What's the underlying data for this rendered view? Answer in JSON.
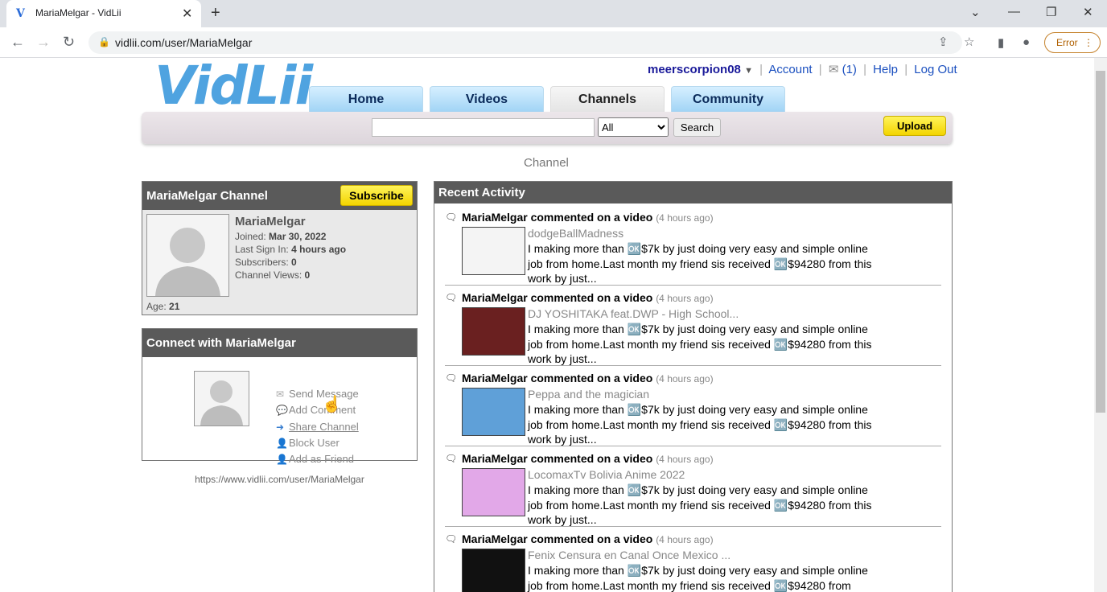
{
  "browser": {
    "tab_title": "MariaMelgar - VidLii",
    "tab_favicon": "vidlii-favicon-icon",
    "url": "vidlii.com/user/MariaMelgar",
    "error_label": "Error"
  },
  "site": {
    "logo_text": "VidLii",
    "username": "meerscorpion08",
    "account_link": "Account",
    "notifications": "(1)",
    "help_link": "Help",
    "logout_link": "Log Out",
    "nav_tabs": [
      {
        "label": "Home",
        "active": false
      },
      {
        "label": "Videos",
        "active": false
      },
      {
        "label": "Channels",
        "active": true
      },
      {
        "label": "Community",
        "active": false
      }
    ],
    "search": {
      "value": "",
      "category": "All",
      "button": "Search"
    },
    "upload": "Upload",
    "section_label": "Channel"
  },
  "profile": {
    "box_title": "MariaMelgar Channel",
    "subscribe": "Subscribe",
    "name": "MariaMelgar",
    "joined_label": "Joined:",
    "joined": "Mar 30, 2022",
    "signin_label": "Last Sign In:",
    "signin": "4 hours ago",
    "subs_label": "Subscribers:",
    "subs": "0",
    "views_label": "Channel Views:",
    "views": "0",
    "age_label": "Age:",
    "age": "21"
  },
  "connect": {
    "box_title": "Connect with MariaMelgar",
    "actions": [
      {
        "label": "Send Message",
        "icon": "envelope-icon"
      },
      {
        "label": "Add Comment",
        "icon": "comment-icon"
      },
      {
        "label": "Share Channel",
        "icon": "share-arrow-icon"
      },
      {
        "label": "Block User",
        "icon": "block-user-icon"
      },
      {
        "label": "Add as Friend",
        "icon": "add-friend-icon"
      }
    ],
    "channel_url": "https://www.vidlii.com/user/MariaMelgar"
  },
  "activity": {
    "box_title": "Recent Activity",
    "items": [
      {
        "head": "MariaMelgar commented on a video",
        "time": "(4 hours ago)",
        "video": "dodgeBallMadness",
        "text": "I making more than 🆗$7k by just doing very easy and simple online job from home.Last month my friend sis received 🆗$94280 from this work by just...",
        "thumb_color": "#f4f4f4"
      },
      {
        "head": "MariaMelgar commented on a video",
        "time": "(4 hours ago)",
        "video": "DJ YOSHITAKA feat.DWP - High School...",
        "text": "I making more than 🆗$7k by just doing very easy and simple online job from home.Last month my friend sis received 🆗$94280 from this work by just...",
        "thumb_color": "#6a2020"
      },
      {
        "head": "MariaMelgar commented on a video",
        "time": "(4 hours ago)",
        "video": "Peppa and the magician",
        "text": "I making more than 🆗$7k by just doing very easy and simple online job from home.Last month my friend sis received 🆗$94280 from this work by just...",
        "thumb_color": "#5fa0d8"
      },
      {
        "head": "MariaMelgar commented on a video",
        "time": "(4 hours ago)",
        "video": "LocomaxTv Bolivia Anime 2022",
        "text": "I making more than 🆗$7k by just doing very easy and simple online job from home.Last month my friend sis received 🆗$94280 from this work by just...",
        "thumb_color": "#e2a8e8"
      },
      {
        "head": "MariaMelgar commented on a video",
        "time": "(4 hours ago)",
        "video": "Fenix Censura en Canal Once Mexico ...",
        "text": "I making more than 🆗$7k by just doing very easy and simple online job from home.Last month my friend sis received 🆗$94280 from",
        "thumb_color": "#111111"
      }
    ]
  }
}
